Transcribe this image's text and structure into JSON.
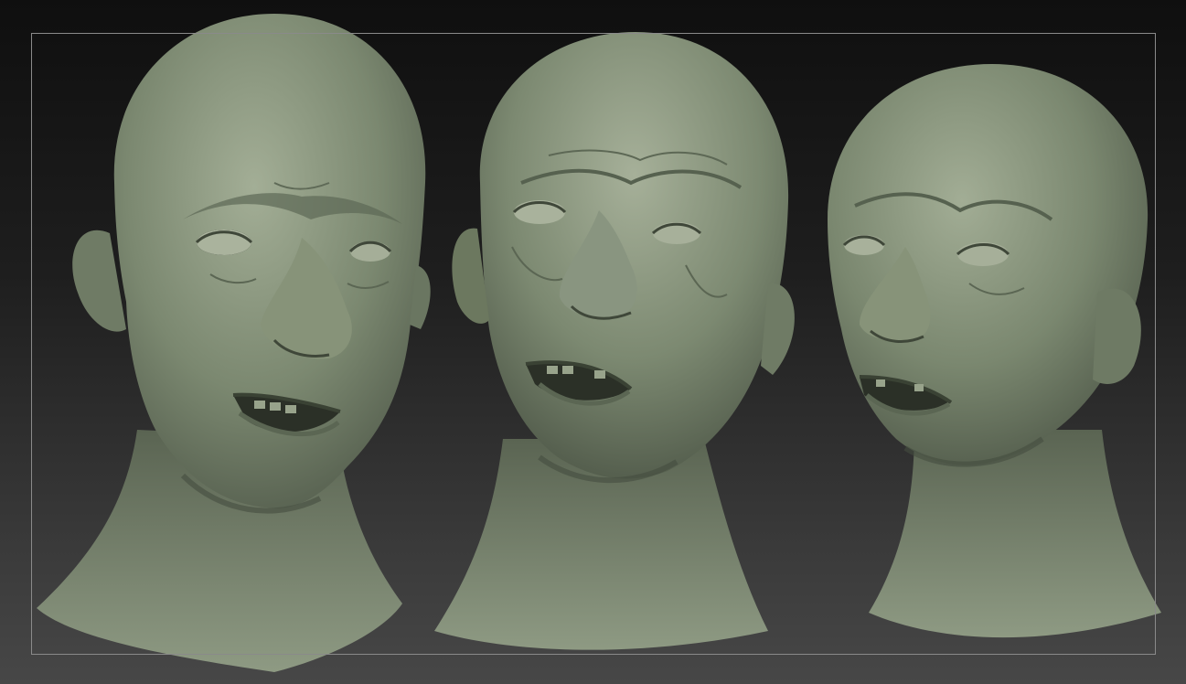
{
  "canvas": {
    "background_top": "#0f0f0f",
    "background_bottom": "#474747",
    "frame_color": "#8a8a8a",
    "clay_color": "#7b8870",
    "clay_shadow": "#4e5748",
    "clay_highlight": "#a3ae96"
  },
  "models": [
    {
      "name": "head-sculpt-left",
      "view": "three-quarter-left"
    },
    {
      "name": "head-sculpt-center",
      "view": "front-low-angle"
    },
    {
      "name": "head-sculpt-right",
      "view": "three-quarter-right"
    }
  ]
}
